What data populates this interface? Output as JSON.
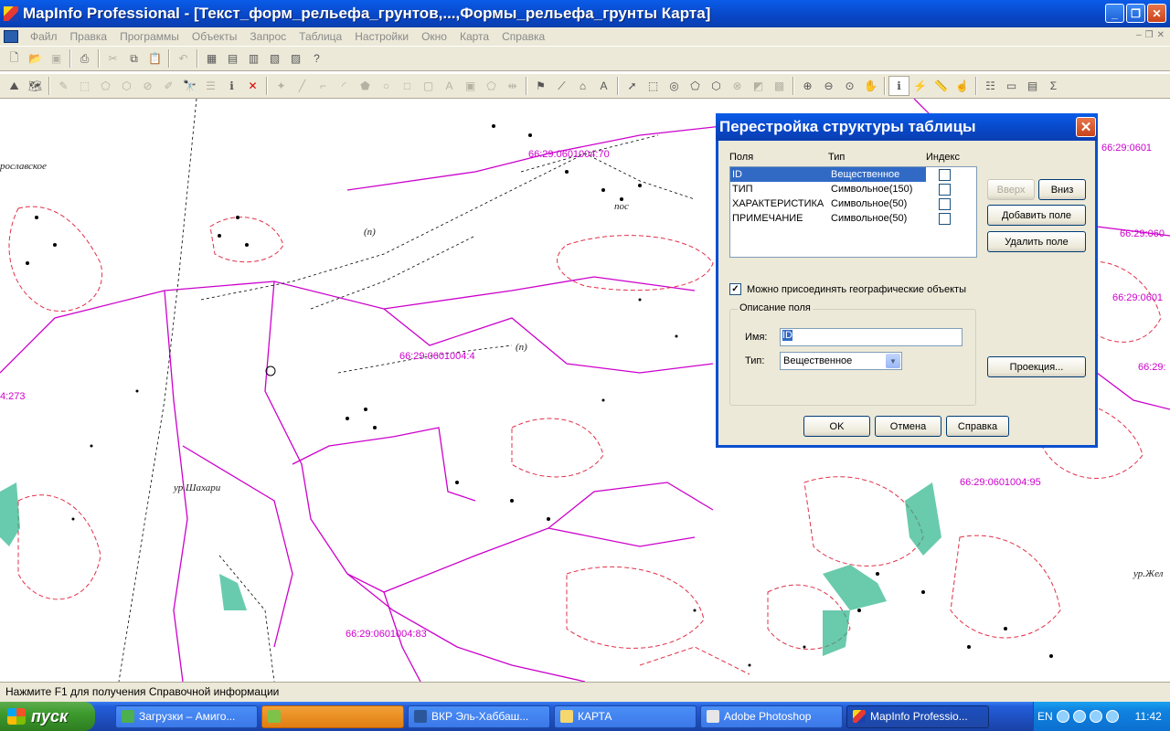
{
  "window": {
    "title": "MapInfo Professional - [Текст_форм_рельефа_грунтов,...,Формы_рельефа_грунты Карта]",
    "minimize": "_",
    "maximize": "❐",
    "close": "✕"
  },
  "menubar": {
    "items": [
      "Файл",
      "Правка",
      "Программы",
      "Объекты",
      "Запрос",
      "Таблица",
      "Настройки",
      "Окно",
      "Карта",
      "Справка"
    ],
    "mdi_buttons": [
      "‒",
      "❐",
      "✕"
    ]
  },
  "map": {
    "parcel_labels": [
      "66:29:0601004:70",
      "66:29:0601004:4",
      "66:29:0601004:95",
      "66:29:0601004:83",
      "66:29:0601",
      "66:29:060",
      "66:29:0601",
      "66:29:",
      "4:273"
    ],
    "place_names": [
      "ур.Шахари",
      "ур.Жел",
      "рославское",
      "пос"
    ],
    "symbols": [
      "(п)",
      "(п)"
    ]
  },
  "dialog": {
    "title": "Перестройка структуры таблицы",
    "close": "✕",
    "headers": {
      "fields": "Поля",
      "type": "Тип",
      "index": "Индекс"
    },
    "fields": [
      {
        "name": "ID",
        "type": "Вещественное",
        "indexed": false,
        "selected": true
      },
      {
        "name": "ТИП",
        "type": "Символьное(150)",
        "indexed": false,
        "selected": false
      },
      {
        "name": "ХАРАКТЕРИСТИКА",
        "type": "Символьное(50)",
        "indexed": false,
        "selected": false
      },
      {
        "name": "ПРИМЕЧАНИЕ",
        "type": "Символьное(50)",
        "indexed": false,
        "selected": false
      }
    ],
    "buttons": {
      "up": "Вверх",
      "down": "Вниз",
      "add_field": "Добавить поле",
      "delete_field": "Удалить поле",
      "projection": "Проекция...",
      "ok": "OK",
      "cancel": "Отмена",
      "help": "Справка"
    },
    "attach_geo": {
      "label": "Можно присоединять географические объекты",
      "checked": true
    },
    "field_description": {
      "title": "Описание поля",
      "name_label": "Имя:",
      "name_value": "ID",
      "type_label": "Тип:",
      "type_value": "Вещественное"
    }
  },
  "statusbar": {
    "text": "Нажмите F1 для получения Справочной информации"
  },
  "taskbar": {
    "start": "пуск",
    "tasks": [
      {
        "label": "Загрузки – Амиго...",
        "state": "normal"
      },
      {
        "label": "",
        "state": "highlight"
      },
      {
        "label": "ВКР Эль-Хаббаш...",
        "state": "normal"
      },
      {
        "label": "КАРТА",
        "state": "normal"
      },
      {
        "label": "Adobe Photoshop",
        "state": "normal"
      },
      {
        "label": "MapInfo Professio...",
        "state": "active"
      }
    ],
    "language": "EN",
    "clock": "11:42"
  }
}
